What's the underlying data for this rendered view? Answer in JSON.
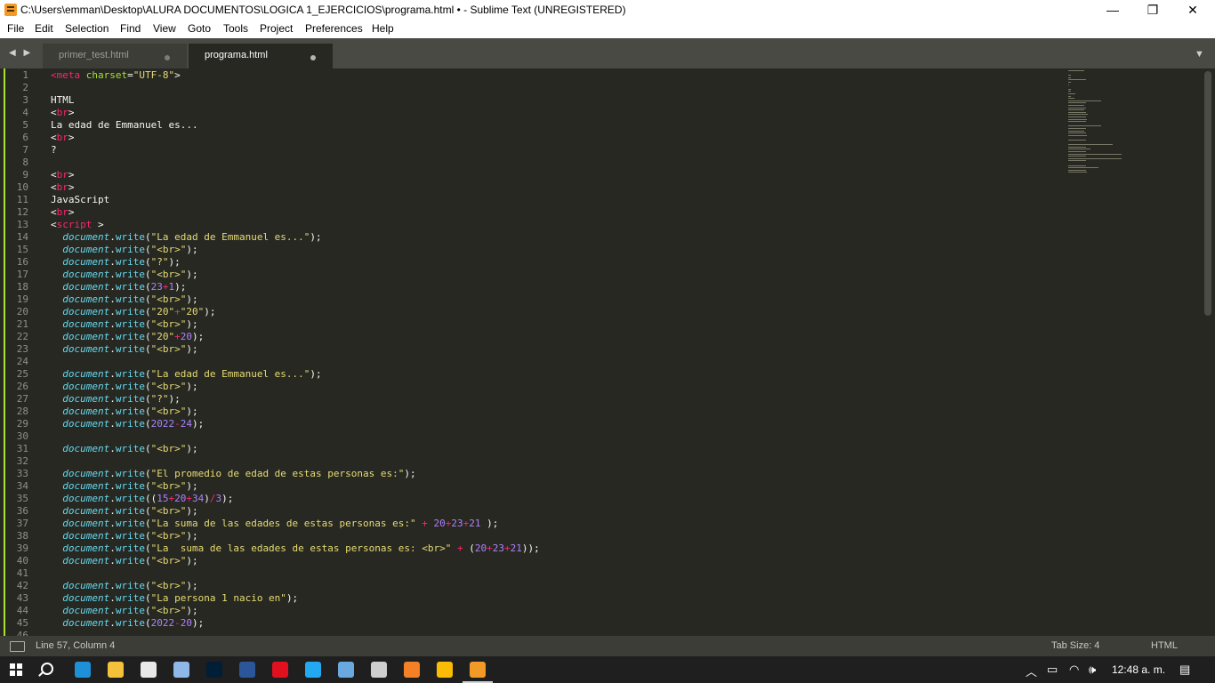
{
  "window": {
    "title": "C:\\Users\\emman\\Desktop\\ALURA DOCUMENTOS\\LOGICA 1_EJERCICIOS\\programa.html • - Sublime Text (UNREGISTERED)",
    "minimize": "—",
    "maximize": "❐",
    "close": "✕"
  },
  "menu": [
    "File",
    "Edit",
    "Selection",
    "Find",
    "View",
    "Goto",
    "Tools",
    "Project",
    "Preferences",
    "Help"
  ],
  "tabs": [
    {
      "label": "primer_test.html",
      "active": false
    },
    {
      "label": "programa.html",
      "active": true
    }
  ],
  "nav_arrows": "◀ ▶",
  "tab_menu_arrow": "▼",
  "editor": {
    "line_numbers": [
      "1",
      "2",
      "3",
      "4",
      "5",
      "6",
      "7",
      "8",
      "9",
      "10",
      "11",
      "12",
      "13",
      "14",
      "15",
      "16",
      "17",
      "18",
      "19",
      "20",
      "21",
      "22",
      "23",
      "24",
      "25",
      "26",
      "27",
      "28",
      "29",
      "30",
      "31",
      "32",
      "33",
      "34",
      "35",
      "36",
      "37",
      "38",
      "39",
      "40",
      "41",
      "42",
      "43",
      "44",
      "45",
      "46"
    ],
    "lines": [
      [
        [
          "t",
          "<meta"
        ],
        [
          "p",
          " "
        ],
        [
          "a",
          "charset"
        ],
        [
          "p",
          "="
        ],
        [
          "s",
          "\"UTF-8\""
        ],
        [
          "p",
          ">"
        ]
      ],
      [],
      [
        [
          "p",
          "HTML"
        ]
      ],
      [
        [
          "p",
          "<"
        ],
        [
          "t",
          "br"
        ],
        [
          "p",
          ">"
        ]
      ],
      [
        [
          "p",
          "La edad de Emmanuel es..."
        ]
      ],
      [
        [
          "p",
          "<"
        ],
        [
          "t",
          "br"
        ],
        [
          "p",
          ">"
        ]
      ],
      [
        [
          "p",
          "?"
        ]
      ],
      [],
      [
        [
          "p",
          "<"
        ],
        [
          "t",
          "br"
        ],
        [
          "p",
          ">"
        ]
      ],
      [
        [
          "p",
          "<"
        ],
        [
          "t",
          "br"
        ],
        [
          "p",
          ">"
        ]
      ],
      [
        [
          "p",
          "JavaScript"
        ]
      ],
      [
        [
          "p",
          "<"
        ],
        [
          "t",
          "br"
        ],
        [
          "p",
          ">"
        ]
      ],
      [
        [
          "p",
          "<"
        ],
        [
          "t",
          "script"
        ],
        [
          "p",
          " >"
        ]
      ],
      [
        [
          "p",
          "  "
        ],
        [
          "d",
          "document"
        ],
        [
          "p",
          "."
        ],
        [
          "f",
          "write"
        ],
        [
          "p",
          "("
        ],
        [
          "s",
          "\"La edad de Emmanuel es...\""
        ],
        [
          "p",
          ");"
        ]
      ],
      [
        [
          "p",
          "  "
        ],
        [
          "d",
          "document"
        ],
        [
          "p",
          "."
        ],
        [
          "f",
          "write"
        ],
        [
          "p",
          "("
        ],
        [
          "s",
          "\"<br>\""
        ],
        [
          "p",
          ");"
        ]
      ],
      [
        [
          "p",
          "  "
        ],
        [
          "d",
          "document"
        ],
        [
          "p",
          "."
        ],
        [
          "f",
          "write"
        ],
        [
          "p",
          "("
        ],
        [
          "s",
          "\"?\""
        ],
        [
          "p",
          ");"
        ]
      ],
      [
        [
          "p",
          "  "
        ],
        [
          "d",
          "document"
        ],
        [
          "p",
          "."
        ],
        [
          "f",
          "write"
        ],
        [
          "p",
          "("
        ],
        [
          "s",
          "\"<br>\""
        ],
        [
          "p",
          ");"
        ]
      ],
      [
        [
          "p",
          "  "
        ],
        [
          "d",
          "document"
        ],
        [
          "p",
          "."
        ],
        [
          "f",
          "write"
        ],
        [
          "p",
          "("
        ],
        [
          "n",
          "23"
        ],
        [
          "o",
          "+"
        ],
        [
          "n",
          "1"
        ],
        [
          "p",
          ");"
        ]
      ],
      [
        [
          "p",
          "  "
        ],
        [
          "d",
          "document"
        ],
        [
          "p",
          "."
        ],
        [
          "f",
          "write"
        ],
        [
          "p",
          "("
        ],
        [
          "s",
          "\"<br>\""
        ],
        [
          "p",
          ");"
        ]
      ],
      [
        [
          "p",
          "  "
        ],
        [
          "d",
          "document"
        ],
        [
          "p",
          "."
        ],
        [
          "f",
          "write"
        ],
        [
          "p",
          "("
        ],
        [
          "s",
          "\"20\""
        ],
        [
          "o",
          "+"
        ],
        [
          "s",
          "\"20\""
        ],
        [
          "p",
          ");"
        ]
      ],
      [
        [
          "p",
          "  "
        ],
        [
          "d",
          "document"
        ],
        [
          "p",
          "."
        ],
        [
          "f",
          "write"
        ],
        [
          "p",
          "("
        ],
        [
          "s",
          "\"<br>\""
        ],
        [
          "p",
          ");"
        ]
      ],
      [
        [
          "p",
          "  "
        ],
        [
          "d",
          "document"
        ],
        [
          "p",
          "."
        ],
        [
          "f",
          "write"
        ],
        [
          "p",
          "("
        ],
        [
          "s",
          "\"20\""
        ],
        [
          "o",
          "+"
        ],
        [
          "n",
          "20"
        ],
        [
          "p",
          ");"
        ]
      ],
      [
        [
          "p",
          "  "
        ],
        [
          "d",
          "document"
        ],
        [
          "p",
          "."
        ],
        [
          "f",
          "write"
        ],
        [
          "p",
          "("
        ],
        [
          "s",
          "\"<br>\""
        ],
        [
          "p",
          ");"
        ]
      ],
      [],
      [
        [
          "p",
          "  "
        ],
        [
          "d",
          "document"
        ],
        [
          "p",
          "."
        ],
        [
          "f",
          "write"
        ],
        [
          "p",
          "("
        ],
        [
          "s",
          "\"La edad de Emmanuel es...\""
        ],
        [
          "p",
          ");"
        ]
      ],
      [
        [
          "p",
          "  "
        ],
        [
          "d",
          "document"
        ],
        [
          "p",
          "."
        ],
        [
          "f",
          "write"
        ],
        [
          "p",
          "("
        ],
        [
          "s",
          "\"<br>\""
        ],
        [
          "p",
          ");"
        ]
      ],
      [
        [
          "p",
          "  "
        ],
        [
          "d",
          "document"
        ],
        [
          "p",
          "."
        ],
        [
          "f",
          "write"
        ],
        [
          "p",
          "("
        ],
        [
          "s",
          "\"?\""
        ],
        [
          "p",
          ");"
        ]
      ],
      [
        [
          "p",
          "  "
        ],
        [
          "d",
          "document"
        ],
        [
          "p",
          "."
        ],
        [
          "f",
          "write"
        ],
        [
          "p",
          "("
        ],
        [
          "s",
          "\"<br>\""
        ],
        [
          "p",
          ");"
        ]
      ],
      [
        [
          "p",
          "  "
        ],
        [
          "d",
          "document"
        ],
        [
          "p",
          "."
        ],
        [
          "f",
          "write"
        ],
        [
          "p",
          "("
        ],
        [
          "n",
          "2022"
        ],
        [
          "o",
          "-"
        ],
        [
          "n",
          "24"
        ],
        [
          "p",
          ");"
        ]
      ],
      [],
      [
        [
          "p",
          "  "
        ],
        [
          "d",
          "document"
        ],
        [
          "p",
          "."
        ],
        [
          "f",
          "write"
        ],
        [
          "p",
          "("
        ],
        [
          "s",
          "\"<br>\""
        ],
        [
          "p",
          ");"
        ]
      ],
      [],
      [
        [
          "p",
          "  "
        ],
        [
          "d",
          "document"
        ],
        [
          "p",
          "."
        ],
        [
          "f",
          "write"
        ],
        [
          "p",
          "("
        ],
        [
          "s",
          "\"El promedio de edad de estas personas es:\""
        ],
        [
          "p",
          ");"
        ]
      ],
      [
        [
          "p",
          "  "
        ],
        [
          "d",
          "document"
        ],
        [
          "p",
          "."
        ],
        [
          "f",
          "write"
        ],
        [
          "p",
          "("
        ],
        [
          "s",
          "\"<br>\""
        ],
        [
          "p",
          ");"
        ]
      ],
      [
        [
          "p",
          "  "
        ],
        [
          "d",
          "document"
        ],
        [
          "p",
          "."
        ],
        [
          "f",
          "write"
        ],
        [
          "p",
          "(("
        ],
        [
          "n",
          "15"
        ],
        [
          "o",
          "+"
        ],
        [
          "n",
          "20"
        ],
        [
          "o",
          "+"
        ],
        [
          "n",
          "34"
        ],
        [
          "p",
          ")"
        ],
        [
          "o",
          "/"
        ],
        [
          "n",
          "3"
        ],
        [
          "p",
          ");"
        ]
      ],
      [
        [
          "p",
          "  "
        ],
        [
          "d",
          "document"
        ],
        [
          "p",
          "."
        ],
        [
          "f",
          "write"
        ],
        [
          "p",
          "("
        ],
        [
          "s",
          "\"<br>\""
        ],
        [
          "p",
          ");"
        ]
      ],
      [
        [
          "p",
          "  "
        ],
        [
          "d",
          "document"
        ],
        [
          "p",
          "."
        ],
        [
          "f",
          "write"
        ],
        [
          "p",
          "("
        ],
        [
          "s",
          "\"La suma de las edades de estas personas es:\""
        ],
        [
          "p",
          " "
        ],
        [
          "o",
          "+"
        ],
        [
          "p",
          " "
        ],
        [
          "n",
          "20"
        ],
        [
          "o",
          "+"
        ],
        [
          "n",
          "23"
        ],
        [
          "o",
          "+"
        ],
        [
          "n",
          "21"
        ],
        [
          "p",
          " );"
        ]
      ],
      [
        [
          "p",
          "  "
        ],
        [
          "d",
          "document"
        ],
        [
          "p",
          "."
        ],
        [
          "f",
          "write"
        ],
        [
          "p",
          "("
        ],
        [
          "s",
          "\"<br>\""
        ],
        [
          "p",
          ");"
        ]
      ],
      [
        [
          "p",
          "  "
        ],
        [
          "d",
          "document"
        ],
        [
          "p",
          "."
        ],
        [
          "f",
          "write"
        ],
        [
          "p",
          "("
        ],
        [
          "s",
          "\"La  suma de las edades de estas personas es: <br>\""
        ],
        [
          "p",
          " "
        ],
        [
          "o",
          "+"
        ],
        [
          "p",
          " ("
        ],
        [
          "n",
          "20"
        ],
        [
          "o",
          "+"
        ],
        [
          "n",
          "23"
        ],
        [
          "o",
          "+"
        ],
        [
          "n",
          "21"
        ],
        [
          "p",
          "));"
        ]
      ],
      [
        [
          "p",
          "  "
        ],
        [
          "d",
          "document"
        ],
        [
          "p",
          "."
        ],
        [
          "f",
          "write"
        ],
        [
          "p",
          "("
        ],
        [
          "s",
          "\"<br>\""
        ],
        [
          "p",
          ");"
        ]
      ],
      [],
      [
        [
          "p",
          "  "
        ],
        [
          "d",
          "document"
        ],
        [
          "p",
          "."
        ],
        [
          "f",
          "write"
        ],
        [
          "p",
          "("
        ],
        [
          "s",
          "\"<br>\""
        ],
        [
          "p",
          ");"
        ]
      ],
      [
        [
          "p",
          "  "
        ],
        [
          "d",
          "document"
        ],
        [
          "p",
          "."
        ],
        [
          "f",
          "write"
        ],
        [
          "p",
          "("
        ],
        [
          "s",
          "\"La persona 1 nacio en\""
        ],
        [
          "p",
          ");"
        ]
      ],
      [
        [
          "p",
          "  "
        ],
        [
          "d",
          "document"
        ],
        [
          "p",
          "."
        ],
        [
          "f",
          "write"
        ],
        [
          "p",
          "("
        ],
        [
          "s",
          "\"<br>\""
        ],
        [
          "p",
          ");"
        ]
      ],
      [
        [
          "p",
          "  "
        ],
        [
          "d",
          "document"
        ],
        [
          "p",
          "."
        ],
        [
          "f",
          "write"
        ],
        [
          "p",
          "("
        ],
        [
          "n",
          "2022"
        ],
        [
          "o",
          "-"
        ],
        [
          "n",
          "20"
        ],
        [
          "p",
          ");"
        ]
      ],
      []
    ]
  },
  "status": {
    "position": "Line 57, Column 4",
    "tab_size": "Tab Size: 4",
    "syntax": "HTML"
  },
  "taskbar": {
    "apps": [
      "edge-icon",
      "file-explorer-icon",
      "emoji-app-icon",
      "notepad-icon",
      "photoshop-icon",
      "word-icon",
      "opera-icon",
      "vscode-icon",
      "cube-app-icon",
      "github-desktop-icon",
      "sublime-merge-icon",
      "chrome-icon",
      "sublime-text-icon"
    ],
    "app_colors": [
      "#1e90d8",
      "#f3c13a",
      "#e8e8e8",
      "#8fb7e8",
      "#001e36",
      "#2b579a",
      "#e0101e",
      "#23a9f2",
      "#6aa8e0",
      "#cfcfcf",
      "#f58025",
      "#fbbc05",
      "#f29a28"
    ],
    "clock": "12:48 a. m."
  },
  "colors": {
    "editor_bg": "#272822",
    "tag": "#f92672",
    "string": "#e6db74",
    "number": "#ae81ff",
    "attribute": "#a6e22e",
    "support": "#66d9ef"
  }
}
